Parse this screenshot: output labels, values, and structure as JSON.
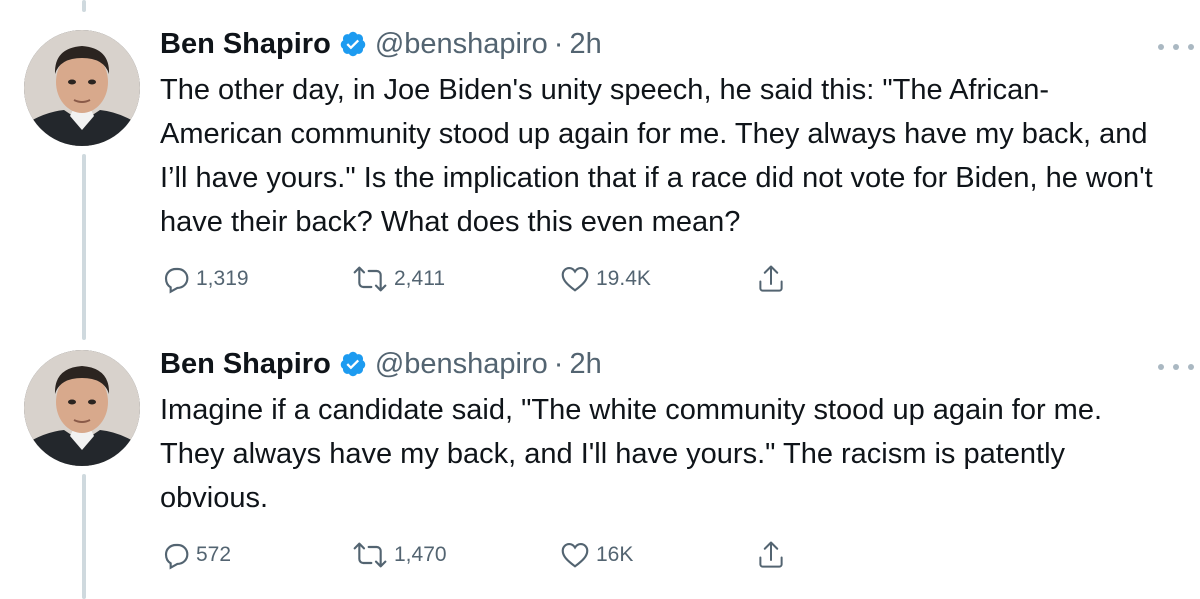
{
  "tweets": [
    {
      "author_name": "Ben Shapiro",
      "handle": "@benshapiro",
      "separator": "·",
      "time": "2h",
      "text": "The other day, in Joe Biden's unity speech, he said this: \"The African-American community stood up again for me. They always have my back, and I’ll have yours.\" Is the implication that if a race did not vote for Biden, he won't have their back? What does this even mean?",
      "replies": "1,319",
      "retweets": "2,411",
      "likes": "19.4K"
    },
    {
      "author_name": "Ben Shapiro",
      "handle": "@benshapiro",
      "separator": "·",
      "time": "2h",
      "text": "Imagine if a candidate said, \"The white community stood up again for me. They always have my back, and I'll have yours.\" The racism is patently obvious.",
      "replies": "572",
      "retweets": "1,470",
      "likes": "16K"
    }
  ],
  "icons": {
    "verified": "verified-badge-icon",
    "reply": "reply-icon",
    "retweet": "retweet-icon",
    "like": "heart-icon",
    "share": "share-icon",
    "more": "more-icon"
  },
  "colors": {
    "verified": "#1d9bf0",
    "secondary_text": "#536471",
    "thread_line": "#cfd9de"
  }
}
